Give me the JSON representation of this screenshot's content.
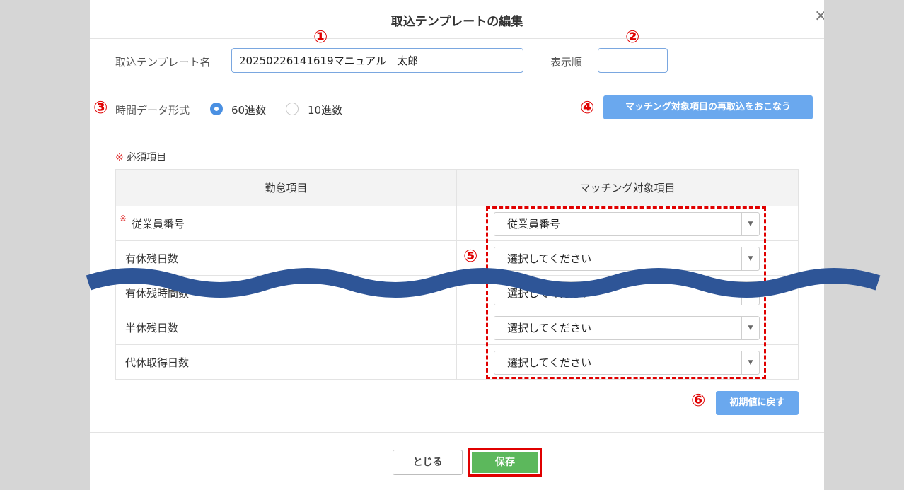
{
  "dialog": {
    "title": "取込テンプレートの編集",
    "close_label": "×"
  },
  "form": {
    "template_name_label": "取込テンプレート名",
    "template_name_value": "20250226141619マニュアル　太郎",
    "display_order_label": "表示順",
    "display_order_value": "",
    "time_format_label": "時間データ形式",
    "time_format_options": [
      {
        "label": "60進数",
        "selected": true
      },
      {
        "label": "10進数",
        "selected": false
      }
    ],
    "rematch_button_label": "マッチング対象項目の再取込をおこなう"
  },
  "required": {
    "mark": "※",
    "label": "必須項目"
  },
  "table": {
    "headers": [
      "勤怠項目",
      "マッチング対象項目"
    ],
    "rows": [
      {
        "item": "従業員番号",
        "required": true,
        "selection": "従業員番号"
      },
      {
        "item": "有休残日数",
        "required": false,
        "selection": "選択してください"
      },
      {
        "item": "有休残時間数",
        "required": false,
        "selection": "選択してください"
      },
      {
        "item": "半休残日数",
        "required": false,
        "selection": "選択してください"
      },
      {
        "item": "代休取得日数",
        "required": false,
        "selection": "選択してください"
      }
    ],
    "dropdown_arrow": "▼"
  },
  "reset_button_label": "初期値に戻す",
  "footer": {
    "close_label": "とじる",
    "save_label": "保存"
  },
  "annotations": [
    "①",
    "②",
    "③",
    "④",
    "⑤",
    "⑥"
  ],
  "colors": {
    "primary_blue": "#6aa8ee",
    "radio_blue": "#4a90e2",
    "save_green": "#5cb85c",
    "annotation_red": "#e00000",
    "wave_blue": "#2e5597"
  }
}
